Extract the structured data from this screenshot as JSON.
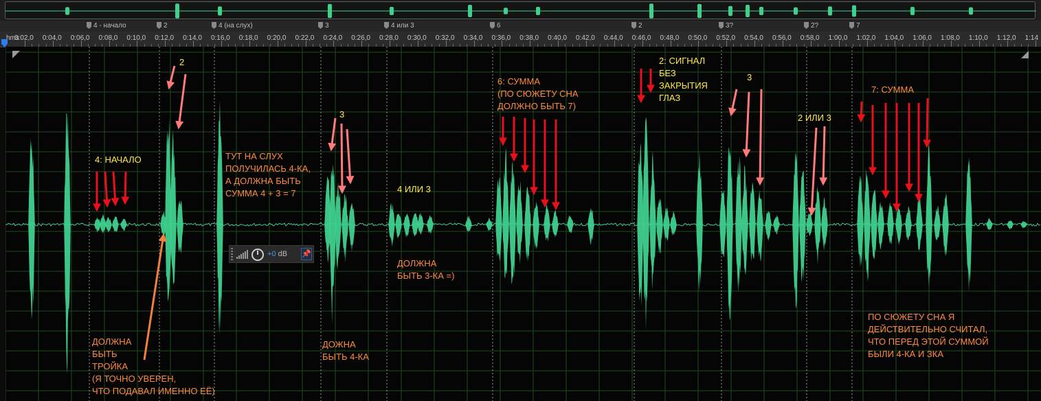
{
  "overview": {
    "spikes": [
      0.47,
      0.9,
      0.55,
      0.85,
      0.5,
      0.75,
      0.4,
      0.5,
      0.9,
      0.85,
      0.6,
      0.75,
      0.5,
      0.45,
      0.55,
      0.7,
      0.5,
      0.45
    ]
  },
  "markers": [
    {
      "label": "4 - начало"
    },
    {
      "label": "2"
    },
    {
      "label": "4 (на слух)"
    },
    {
      "label": "3"
    },
    {
      "label": "4 или 3"
    },
    {
      "label": "6"
    },
    {
      "label": "2"
    },
    {
      "label": "3?"
    },
    {
      "label": "2?"
    },
    {
      "label": "7"
    }
  ],
  "ruler": {
    "unit_label": "hms",
    "labels": [
      "0:02,0",
      "0:04,0",
      "0:06,0",
      "0:08,0",
      "0:10,0",
      "0:12,0",
      "0:14,0",
      "0:16,0",
      "0:18,0",
      "0:20,0",
      "0:22,0",
      "0:24,0",
      "0:26,0",
      "0:28,0",
      "0:30,0",
      "0:32,0",
      "0:34,0",
      "0:36,0",
      "0:38,0",
      "0:40,0",
      "0:42,0",
      "0:44,0",
      "0:46,0",
      "0:48,0",
      "0:50,0",
      "0:52,0",
      "0:54,0",
      "0:56,0",
      "0:58,0",
      "1:00,0",
      "1:02,0",
      "1:04,0",
      "1:06,0",
      "1:08,0",
      "1:10,0",
      "1:12,0",
      "1:14"
    ]
  },
  "hud": {
    "gain_value": "+0",
    "gain_unit": "dB",
    "pin_icon": "pin-icon"
  },
  "annotations": {
    "n1": {
      "lines": [
        "4: НАЧАЛО"
      ]
    },
    "n2": {
      "lines": [
        "2"
      ]
    },
    "n3": {
      "lines": [
        "ТУТ НА СЛУХ",
        "ПОЛУЧИЛАСЬ 4-КА,",
        "А ДОЛЖНА БЫТЬ",
        "СУММА 4 + 3 = 7"
      ]
    },
    "n4": {
      "lines": [
        "3"
      ]
    },
    "n5": {
      "lines": [
        "4 ИЛИ 3"
      ]
    },
    "n6": {
      "lines": [
        "ДОЛЖНА",
        "БЫТЬ 3-КА =)"
      ]
    },
    "n7": {
      "lines": [
        "6: СУММА",
        "(ПО СЮЖЕТУ СНА",
        "ДОЛЖНО БЫТЬ 7)"
      ]
    },
    "n8": {
      "lines": [
        "2: СИГНАЛ",
        "БЕЗ",
        "ЗАКРЫТИЯ",
        "ГЛАЗ"
      ]
    },
    "n9": {
      "lines": [
        "3"
      ]
    },
    "n10": {
      "lines": [
        "2 ИЛИ 3"
      ]
    },
    "n11": {
      "lines": [
        "7: СУММА"
      ]
    },
    "n12": {
      "lines": [
        "ДОЛЖНА",
        "БЫТЬ",
        "ТРОЙКА",
        "(Я ТОЧНО УВЕРЕН,",
        "ЧТО ПОДАВАЛ ИМЕННО ЕЁ)"
      ]
    },
    "n13": {
      "lines": [
        "ДОЖНА",
        "БЫТЬ 4-КА"
      ]
    },
    "n14": {
      "lines": [
        "ПО СЮЖЕТУ СНА Я",
        "ДЕЙСТВИТЕЛЬНО СЧИТАЛ,",
        "ЧТО ПЕРЕД ЭТОЙ СУММОЙ",
        "БЫЛИ 4-КА И ЗКА"
      ]
    }
  },
  "colors": {
    "waveform": "#3fd08e",
    "grid": "#1f4a1f",
    "arrow_red": "#e8101a",
    "arrow_pink": "#ff7a7a",
    "arrow_orange": "#f08040",
    "text_yellow": "#ffe84a",
    "text_orange": "#ff8a40"
  }
}
